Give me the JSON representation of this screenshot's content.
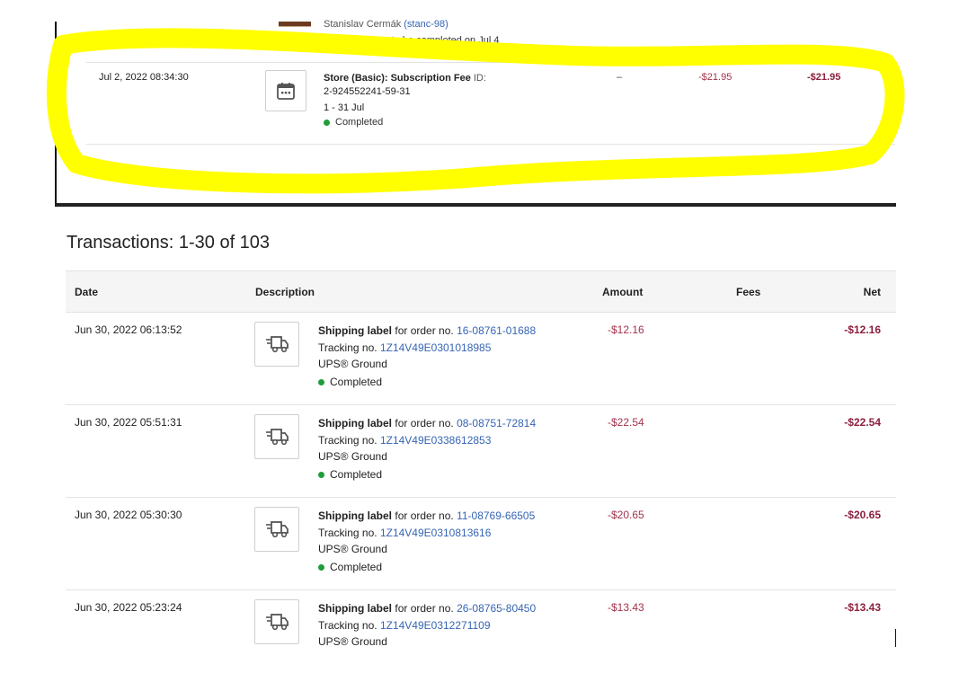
{
  "top_panel": {
    "seller_name": "Stanislav Cermák",
    "seller_handle": "(stanc-98)",
    "processing_status": "Processing : to be completed on Jul 4",
    "transaction": {
      "date": "Jul 2, 2022 08:34:30",
      "icon": "calendar-icon",
      "title": "Store (Basic): Subscription Fee",
      "id_label": "ID:",
      "id_value": "2-924552241-59-31",
      "period": "1 - 31 Jul",
      "status": "Completed",
      "fees": "–",
      "amount": "-$21.95",
      "net": "-$21.95"
    },
    "highlight_color": "#ffff00"
  },
  "transactions": {
    "title": "Transactions: 1-30 of 103",
    "headers": {
      "date": "Date",
      "description": "Description",
      "amount": "Amount",
      "fees": "Fees",
      "net": "Net"
    },
    "rows": [
      {
        "date": "Jun 30, 2022 06:13:52",
        "label": "Shipping label",
        "order_prefix": "for order no.",
        "order_no": "16-08761-01688",
        "tracking_prefix": "Tracking no.",
        "tracking_no": "1Z14V49E0301018985",
        "carrier": "UPS® Ground",
        "status": "Completed",
        "amount": "-$12.16",
        "net": "-$12.16"
      },
      {
        "date": "Jun 30, 2022 05:51:31",
        "label": "Shipping label",
        "order_prefix": "for order no.",
        "order_no": "08-08751-72814",
        "tracking_prefix": "Tracking no.",
        "tracking_no": "1Z14V49E0338612853",
        "carrier": "UPS® Ground",
        "status": "Completed",
        "amount": "-$22.54",
        "net": "-$22.54"
      },
      {
        "date": "Jun 30, 2022 05:30:30",
        "label": "Shipping label",
        "order_prefix": "for order no.",
        "order_no": "11-08769-66505",
        "tracking_prefix": "Tracking no.",
        "tracking_no": "1Z14V49E0310813616",
        "carrier": "UPS® Ground",
        "status": "Completed",
        "amount": "-$20.65",
        "net": "-$20.65"
      },
      {
        "date": "Jun 30, 2022 05:23:24",
        "label": "Shipping label",
        "order_prefix": "for order no.",
        "order_no": "26-08765-80450",
        "tracking_prefix": "Tracking no.",
        "tracking_no": "1Z14V49E0312271109",
        "carrier": "UPS® Ground",
        "amount": "-$13.43",
        "net": "-$13.43"
      }
    ]
  },
  "colors": {
    "link": "#3665b3",
    "amount": "#a3324b",
    "net": "#8c1f3d",
    "completed": "#1f9d3a",
    "processing": "#8cb6e6"
  }
}
